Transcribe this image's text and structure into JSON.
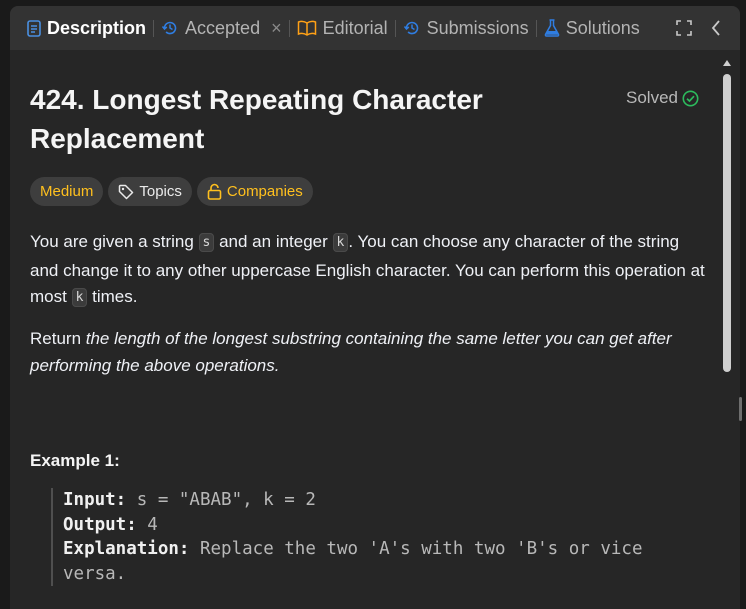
{
  "tabs": [
    {
      "label": "Description",
      "icon": "description-icon",
      "active": true
    },
    {
      "label": "Accepted",
      "icon": "history-icon",
      "closable": true
    },
    {
      "label": "Editorial",
      "icon": "book-icon"
    },
    {
      "label": "Submissions",
      "icon": "history-icon"
    },
    {
      "label": "Solutions",
      "icon": "flask-icon"
    }
  ],
  "toolbar": {
    "close_glyph": "×"
  },
  "problem": {
    "title": "424. Longest Repeating Character Replacement",
    "status": "Solved",
    "difficulty": "Medium",
    "topics_label": "Topics",
    "companies_label": "Companies"
  },
  "description": {
    "p1_a": "You are given a string ",
    "p1_s": "s",
    "p1_b": " and an integer ",
    "p1_k": "k",
    "p1_c": ". You can choose any character of the string and change it to any other uppercase English character. You can perform this operation at most ",
    "p1_k2": "k",
    "p1_d": " times.",
    "p2_a": "Return ",
    "p2_b": "the length of the longest substring containing the same letter you can get after performing the above operations."
  },
  "example": {
    "title": "Example 1:",
    "input_label": "Input:",
    "input_value": " s = \"ABAB\", k = 2",
    "output_label": "Output:",
    "output_value": " 4",
    "explanation_label": "Explanation:",
    "explanation_value_1": " Replace the two 'A's with two 'B's or vice",
    "explanation_value_2": "versa."
  },
  "colors": {
    "accent_solved": "#2cbb5d",
    "medium": "#ffc01e",
    "description_icon": "#4a90e2",
    "history_icon": "#2f7de1",
    "book_icon": "#ffa116",
    "flask_icon": "#2f7de1"
  }
}
